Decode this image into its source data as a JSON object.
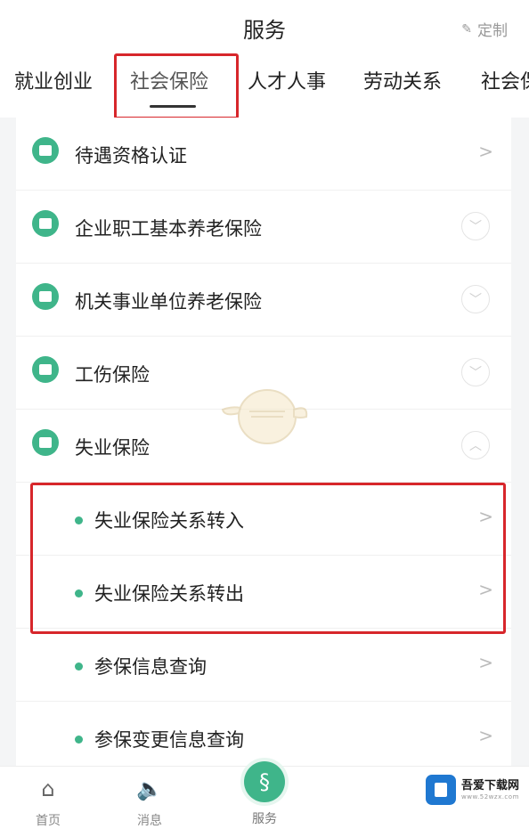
{
  "header": {
    "title": "服务",
    "customize_label": "定制"
  },
  "tabs": [
    "就业创业",
    "社会保险",
    "人才人事",
    "劳动关系",
    "社会保"
  ],
  "list": {
    "items": [
      {
        "label": "待遇资格认证",
        "icon": "certificate-icon",
        "control": "chevron-right"
      },
      {
        "label": "企业职工基本养老保险",
        "icon": "pension-icon",
        "control": "expand-down"
      },
      {
        "label": "机关事业单位养老保险",
        "icon": "institution-pension-icon",
        "control": "expand-down"
      },
      {
        "label": "工伤保险",
        "icon": "injury-insurance-icon",
        "control": "expand-down"
      },
      {
        "label": "失业保险",
        "icon": "unemployment-insurance-icon",
        "control": "collapse-up"
      }
    ],
    "subitems": [
      {
        "label": "失业保险关系转入"
      },
      {
        "label": "失业保险关系转出"
      },
      {
        "label": "参保信息查询"
      },
      {
        "label": "参保变更信息查询"
      }
    ]
  },
  "tabbar": {
    "home": "首页",
    "messages": "消息",
    "services": "服务"
  },
  "watermark": {
    "name": "吾爱下载网",
    "domain": "www.52wzx.com"
  },
  "colors": {
    "accent": "#3fb58a",
    "highlight_box": "#d7262b"
  }
}
